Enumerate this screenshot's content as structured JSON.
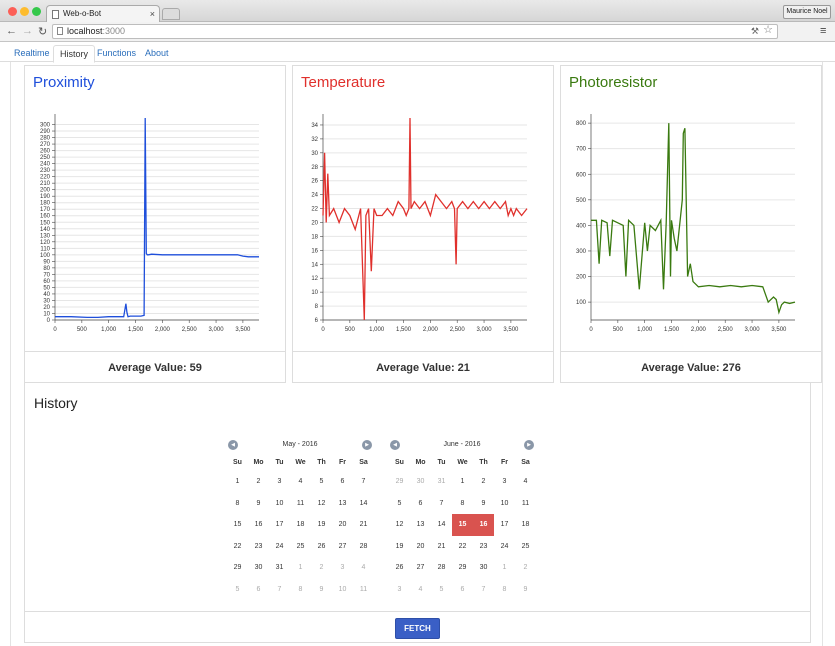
{
  "browser": {
    "tab_title": "Web-o-Bot",
    "url_host": "localhost",
    "url_port": ":3000",
    "user": "Maurice Noel"
  },
  "nav": {
    "tabs": [
      "Realtime",
      "History",
      "Functions",
      "About"
    ],
    "active": "History"
  },
  "panels": [
    {
      "title": "Proximity",
      "color": "#1f4fdb",
      "average_label": "Average Value:",
      "average": "59"
    },
    {
      "title": "Temperature",
      "color": "#e0302c",
      "average_label": "Average Value:",
      "average": "21"
    },
    {
      "title": "Photoresistor",
      "color": "#3a7a10",
      "average_label": "Average Value:",
      "average": "276"
    }
  ],
  "chart_data": [
    {
      "type": "line",
      "title": "Proximity",
      "x_ticks": [
        "0",
        "500",
        "1,000",
        "1,500",
        "2,000",
        "2,500",
        "3,000",
        "3,500"
      ],
      "y_ticks": [
        "0",
        "10",
        "20",
        "30",
        "40",
        "50",
        "60",
        "70",
        "80",
        "90",
        "100",
        "110",
        "120",
        "130",
        "140",
        "150",
        "160",
        "170",
        "180",
        "190",
        "200",
        "210",
        "220",
        "230",
        "240",
        "250",
        "260",
        "270",
        "280",
        "290",
        "300"
      ],
      "xlim": [
        0,
        3800
      ],
      "ylim": [
        0,
        310
      ],
      "grid": true,
      "series": [
        {
          "x": [
            0,
            300,
            600,
            800,
            1000,
            1200,
            1280,
            1300,
            1320,
            1340,
            1360,
            1400,
            1500,
            1600,
            1660,
            1680,
            1700,
            1720,
            1740,
            1800,
            2000,
            2500,
            3000,
            3400,
            3500,
            3600,
            3800
          ],
          "y": [
            5,
            5,
            4,
            4,
            5,
            5,
            5,
            15,
            25,
            12,
            5,
            6,
            6,
            6,
            7,
            310,
            102,
            100,
            100,
            101,
            100,
            100,
            100,
            100,
            98,
            97,
            97
          ]
        }
      ]
    },
    {
      "type": "line",
      "title": "Temperature",
      "x_ticks": [
        "0",
        "500",
        "1,000",
        "1,500",
        "2,000",
        "2,500",
        "3,000",
        "3,500"
      ],
      "y_ticks": [
        "6",
        "8",
        "10",
        "12",
        "14",
        "16",
        "18",
        "20",
        "22",
        "24",
        "26",
        "28",
        "30",
        "32",
        "34"
      ],
      "xlim": [
        0,
        3800
      ],
      "ylim": [
        6,
        35
      ],
      "grid": true,
      "series": [
        {
          "x": [
            0,
            30,
            60,
            90,
            120,
            200,
            300,
            400,
            500,
            600,
            700,
            770,
            800,
            850,
            900,
            950,
            1000,
            1100,
            1200,
            1300,
            1400,
            1500,
            1550,
            1600,
            1620,
            1640,
            1700,
            1800,
            1900,
            2000,
            2100,
            2200,
            2300,
            2400,
            2450,
            2480,
            2500,
            2600,
            2700,
            2800,
            2900,
            3000,
            3100,
            3200,
            3300,
            3400,
            3450,
            3500,
            3550,
            3600,
            3700,
            3800
          ],
          "y": [
            21,
            30,
            20,
            27,
            21,
            22,
            20,
            22,
            21,
            19,
            22,
            6,
            21,
            22,
            13,
            22,
            21,
            21,
            22,
            21,
            23,
            22,
            21,
            22,
            35,
            22,
            23,
            22,
            23,
            21,
            24,
            23,
            22,
            23,
            22,
            14,
            22,
            23,
            22,
            23,
            22,
            23,
            22,
            23,
            22,
            23,
            21,
            22,
            21,
            22,
            21,
            22
          ]
        }
      ]
    },
    {
      "type": "line",
      "title": "Photoresistor",
      "x_ticks": [
        "0",
        "500",
        "1,000",
        "1,500",
        "2,000",
        "2,500",
        "3,000",
        "3,500"
      ],
      "y_ticks": [
        "100",
        "200",
        "300",
        "400",
        "500",
        "600",
        "700",
        "800"
      ],
      "xlim": [
        0,
        3800
      ],
      "ylim": [
        30,
        820
      ],
      "grid": true,
      "series": [
        {
          "x": [
            0,
            100,
            150,
            200,
            300,
            350,
            400,
            500,
            600,
            650,
            700,
            800,
            900,
            1000,
            1050,
            1100,
            1200,
            1300,
            1350,
            1400,
            1450,
            1480,
            1500,
            1550,
            1600,
            1650,
            1700,
            1720,
            1750,
            1800,
            1850,
            1900,
            1950,
            2000,
            2200,
            2400,
            2600,
            2800,
            3000,
            3200,
            3300,
            3400,
            3450,
            3500,
            3550,
            3600,
            3700,
            3800
          ],
          "y": [
            420,
            420,
            250,
            420,
            410,
            280,
            420,
            410,
            400,
            200,
            420,
            400,
            150,
            410,
            300,
            400,
            380,
            420,
            150,
            410,
            800,
            200,
            420,
            350,
            300,
            400,
            500,
            760,
            780,
            200,
            250,
            180,
            170,
            160,
            165,
            160,
            165,
            160,
            165,
            160,
            100,
            120,
            110,
            60,
            90,
            100,
            95,
            100
          ]
        }
      ]
    }
  ],
  "history": {
    "title": "History",
    "weekdays": [
      "Su",
      "Mo",
      "Tu",
      "We",
      "Th",
      "Fr",
      "Sa"
    ],
    "prev_icon": "chevron-left-icon",
    "next_icon": "chevron-right-icon",
    "calendars": [
      {
        "month": "May - 2016",
        "days": [
          "1",
          "2",
          "3",
          "4",
          "5",
          "6",
          "7",
          "8",
          "9",
          "10",
          "11",
          "12",
          "13",
          "14",
          "15",
          "16",
          "17",
          "18",
          "19",
          "20",
          "21",
          "22",
          "23",
          "24",
          "25",
          "26",
          "27",
          "28",
          "29",
          "30",
          "31",
          "1",
          "2",
          "3",
          "4",
          "5",
          "6",
          "7",
          "8",
          "9",
          "10",
          "11"
        ],
        "first_other_after": 31,
        "other_before": 0,
        "selected": []
      },
      {
        "month": "June - 2016",
        "days": [
          "29",
          "30",
          "31",
          "1",
          "2",
          "3",
          "4",
          "5",
          "6",
          "7",
          "8",
          "9",
          "10",
          "11",
          "12",
          "13",
          "14",
          "15",
          "16",
          "17",
          "18",
          "19",
          "20",
          "21",
          "22",
          "23",
          "24",
          "25",
          "26",
          "27",
          "28",
          "29",
          "30",
          "1",
          "2",
          "3",
          "4",
          "5",
          "6",
          "7",
          "8",
          "9"
        ],
        "first_other_after": 33,
        "other_before": 3,
        "selected": [
          17,
          18
        ]
      }
    ],
    "fetch_label": "FETCH"
  }
}
